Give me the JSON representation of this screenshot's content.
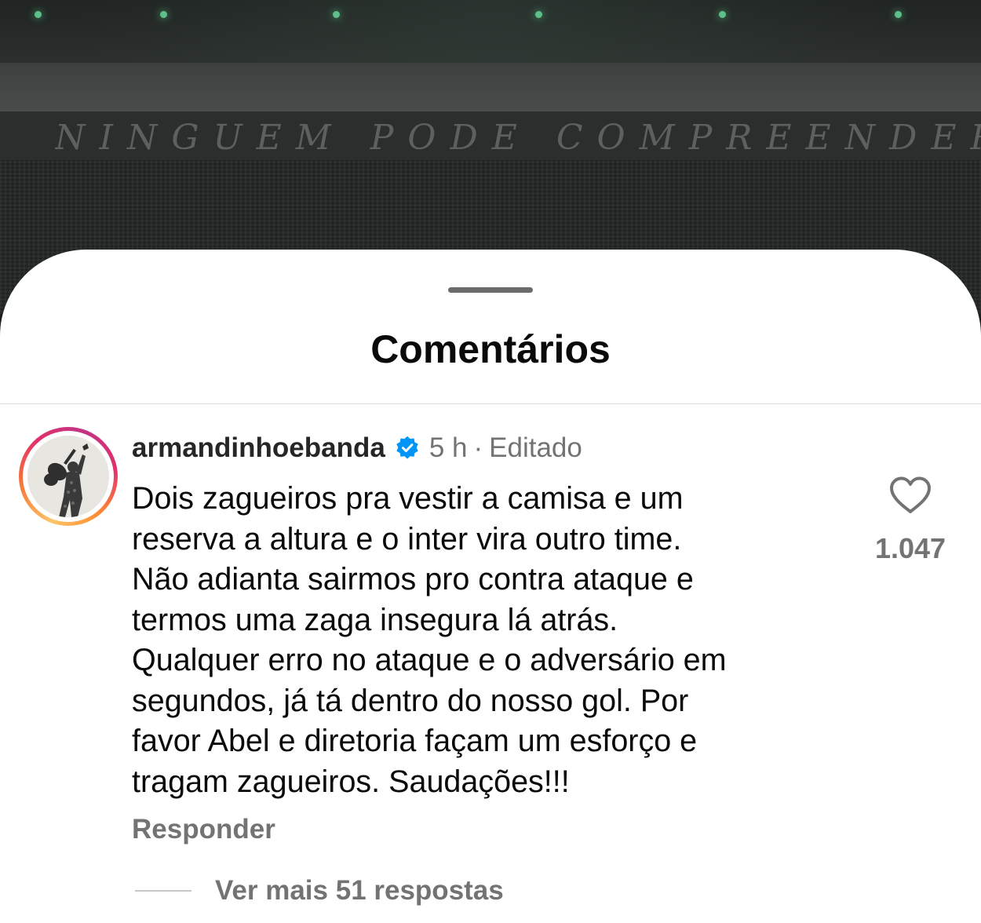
{
  "background": {
    "banner_text": "NINGUEM PODE COMPREENDER"
  },
  "sheet": {
    "title": "Comentários"
  },
  "comment": {
    "username": "armandinhoebanda",
    "verified": true,
    "time": "5 h",
    "separator": "·",
    "edited_label": "Editado",
    "lines": [
      "Dois zagueiros pra vestir a camisa e um",
      "reserva a altura e o inter vira outro time.",
      "Não adianta sairmos pro contra ataque e",
      "termos uma zaga insegura lá atrás.",
      "Qualquer erro no ataque e o adversário em",
      "segundos, já tá dentro do nosso gol. Por",
      "favor Abel e diretoria façam um esforço e",
      "tragam zagueiros. Saudações!!!"
    ],
    "reply_label": "Responder",
    "like_count": "1.047",
    "more_replies_label": "Ver mais 51 respostas"
  },
  "icons": {
    "like": "heart-outline-icon",
    "verified": "verified-badge-icon"
  },
  "colors": {
    "verified_blue": "#0095f6",
    "secondary_text": "#737373",
    "primary_text": "#0a0a0a"
  }
}
